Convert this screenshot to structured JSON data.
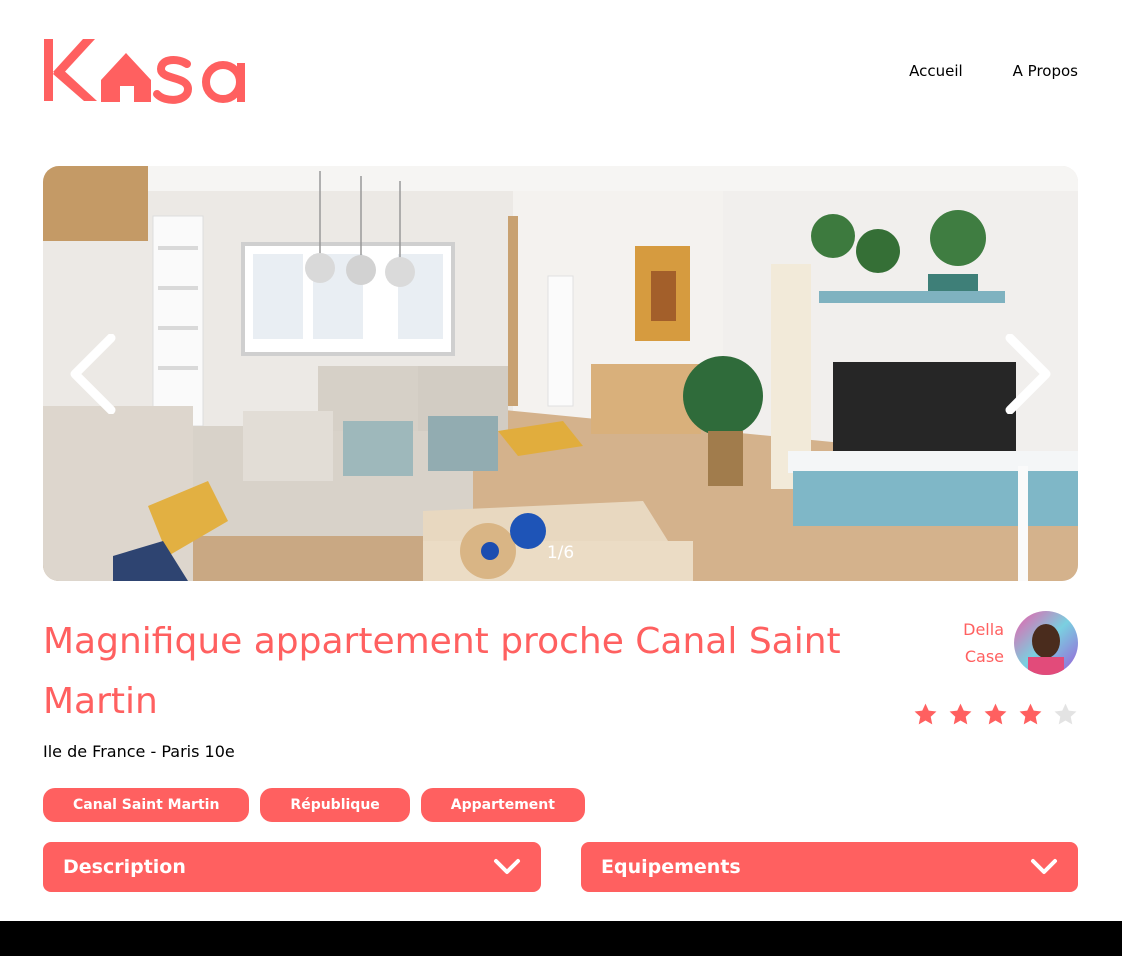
{
  "brand": {
    "logo_text": "Kasa",
    "accent_color": "#ff6060"
  },
  "nav": {
    "items": [
      {
        "label": "Accueil"
      },
      {
        "label": "A Propos"
      }
    ]
  },
  "gallery": {
    "counter": "1/6",
    "prev_icon": "chevron-left-icon",
    "next_icon": "chevron-right-icon"
  },
  "listing": {
    "title": "Magnifique appartement proche Canal Saint Martin",
    "location": "Ile de France - Paris 10e",
    "tags": [
      "Canal Saint Martin",
      "République",
      "Appartement"
    ],
    "rating": {
      "value": 4,
      "max": 5,
      "filled_color": "#ff6060",
      "empty_color": "#e3e3e3"
    }
  },
  "host": {
    "first_name": "Della",
    "last_name": "Case"
  },
  "collapses": [
    {
      "label": "Description",
      "icon": "chevron-down-icon"
    },
    {
      "label": "Equipements",
      "icon": "chevron-down-icon"
    }
  ]
}
